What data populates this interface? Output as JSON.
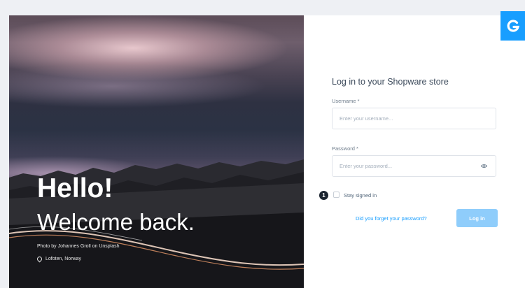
{
  "hero": {
    "greeting": "Hello!",
    "welcome": "Welcome back.",
    "photo_credit": "Photo by Johannes Groll on Unsplash",
    "location": "Lofoten, Norway"
  },
  "login": {
    "title": "Log in to your Shopware store",
    "username_label": "Username *",
    "username_placeholder": "Enter your username...",
    "password_label": "Password *",
    "password_placeholder": "Enter your password...",
    "step_badge": "1",
    "stay_signed_in": "Stay signed in",
    "forgot_password": "Did you forget your password?",
    "login_button": "Log in"
  },
  "colors": {
    "brand": "#189eff",
    "button_disabled": "#8fcdfb",
    "text": "#3d4b5c",
    "badge": "#1b2430"
  },
  "icons": {
    "logo": "shopware-logo-icon",
    "password_toggle": "eye-icon",
    "location": "location-pin-icon"
  }
}
